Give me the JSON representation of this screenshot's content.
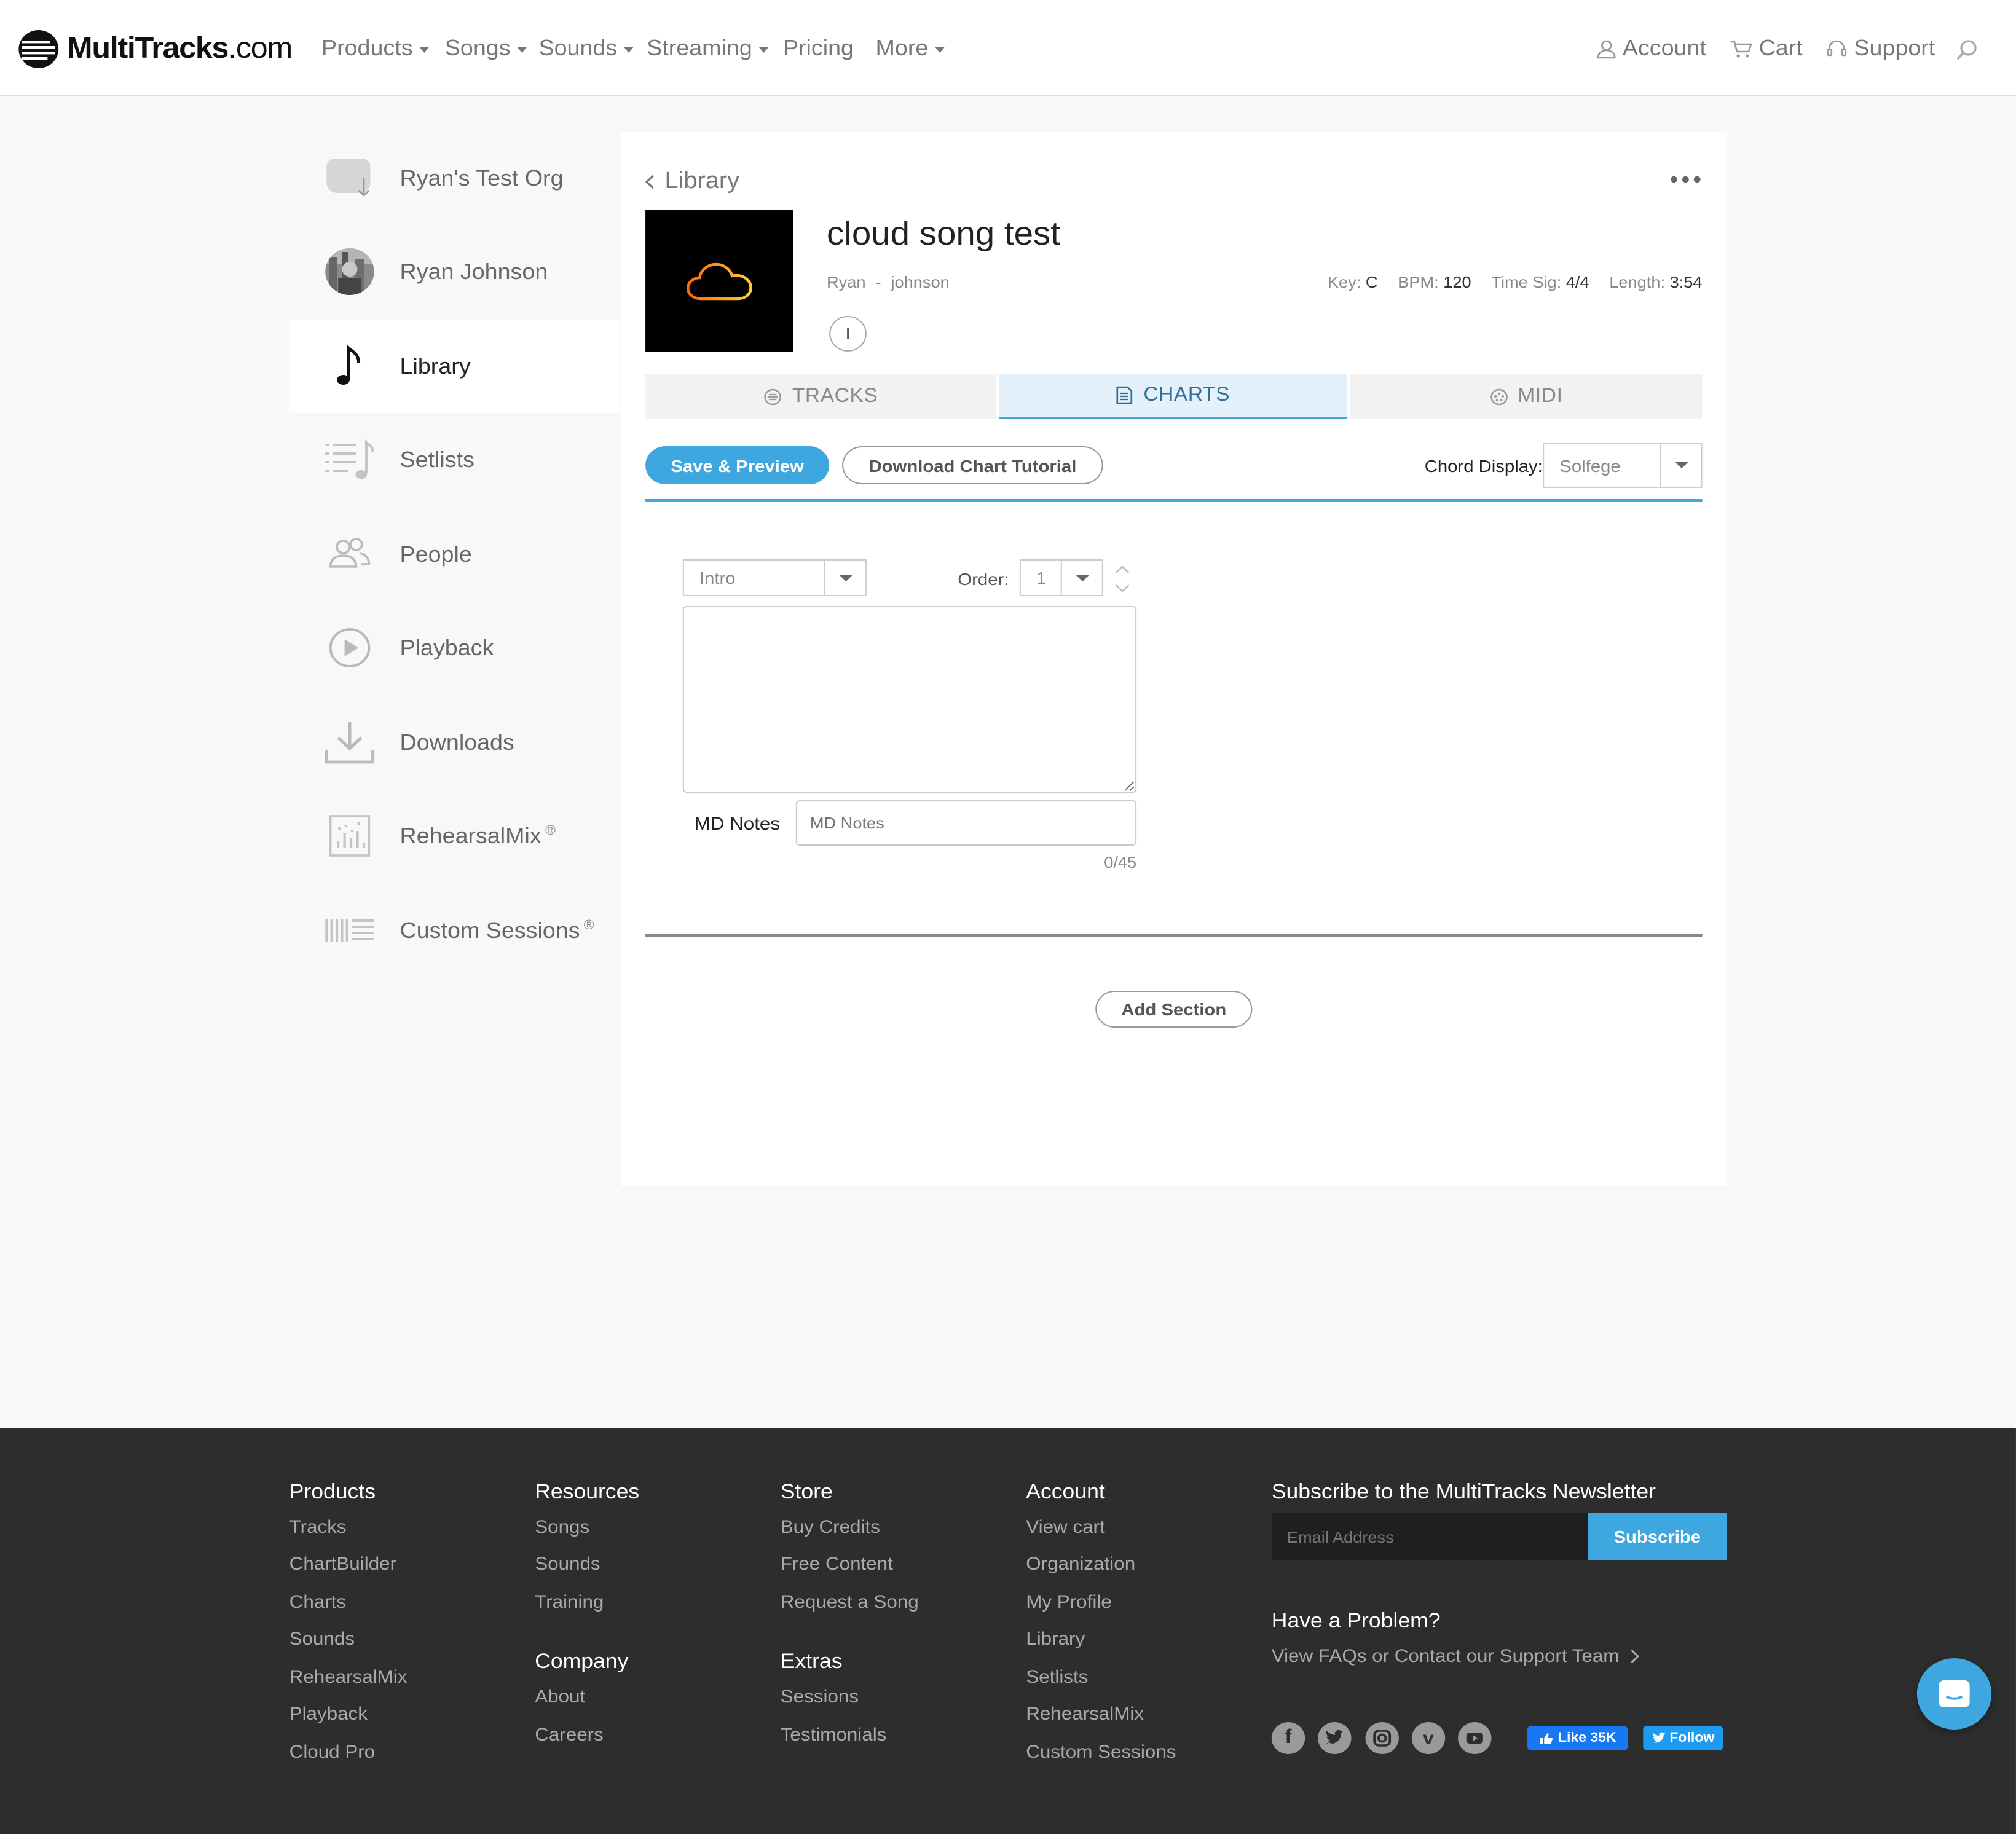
{
  "header": {
    "logo_text": "MultiTracks",
    "logo_suffix": ".com",
    "nav": [
      "Products",
      "Songs",
      "Sounds",
      "Streaming",
      "Pricing",
      "More"
    ],
    "account_label": "Account",
    "cart_label": "Cart",
    "support_label": "Support"
  },
  "sidebar": {
    "items": [
      {
        "label": "Ryan's Test Org",
        "icon": "org-avatar-icon"
      },
      {
        "label": "Ryan Johnson",
        "icon": "user-avatar"
      },
      {
        "label": "Library",
        "icon": "music-note-icon"
      },
      {
        "label": "Setlists",
        "icon": "setlist-icon"
      },
      {
        "label": "People",
        "icon": "people-icon"
      },
      {
        "label": "Playback",
        "icon": "play-circle-icon"
      },
      {
        "label": "Downloads",
        "icon": "download-icon"
      },
      {
        "label": "RehearsalMix",
        "icon": "rehearsalmix-icon",
        "sup": "®"
      },
      {
        "label": "Custom Sessions",
        "icon": "custom-sessions-icon",
        "sup": "®"
      }
    ]
  },
  "song": {
    "back_label": "Library",
    "title": "cloud song test",
    "artist": "Ryan",
    "separator": "-",
    "album": "johnson",
    "key_label": "Key:",
    "key": "C",
    "bpm_label": "BPM:",
    "bpm": "120",
    "timesig_label": "Time Sig:",
    "timesig": "4/4",
    "length_label": "Length:",
    "length": "3:54",
    "badge": "I"
  },
  "tabs": [
    {
      "label": "TRACKS",
      "icon": "tracks-icon",
      "active": false
    },
    {
      "label": "CHARTS",
      "icon": "chart-doc-icon",
      "active": true
    },
    {
      "label": "MIDI",
      "icon": "midi-icon",
      "active": false
    }
  ],
  "toolbar": {
    "save_label": "Save & Preview",
    "download_label": "Download Chart Tutorial",
    "chord_display_label": "Chord Display:",
    "chord_display_value": "Solfege"
  },
  "section": {
    "type_value": "Intro",
    "order_label": "Order:",
    "order_value": "1",
    "chart_text": "",
    "md_notes_label": "MD Notes",
    "md_notes_placeholder": "MD Notes",
    "counter": "0/45"
  },
  "add_section_label": "Add Section",
  "footer": {
    "products": {
      "heading": "Products",
      "links": [
        "Tracks",
        "ChartBuilder",
        "Charts",
        "Sounds",
        "RehearsalMix",
        "Playback",
        "Cloud Pro"
      ]
    },
    "resources": {
      "heading": "Resources",
      "links": [
        "Songs",
        "Sounds",
        "Training"
      ]
    },
    "company": {
      "heading": "Company",
      "links": [
        "About",
        "Careers"
      ]
    },
    "store": {
      "heading": "Store",
      "links": [
        "Buy Credits",
        "Free Content",
        "Request a Song"
      ]
    },
    "extras": {
      "heading": "Extras",
      "links": [
        "Sessions",
        "Testimonials"
      ]
    },
    "account": {
      "heading": "Account",
      "links": [
        "View cart",
        "Organization",
        "My Profile",
        "Library",
        "Setlists",
        "RehearsalMix",
        "Custom Sessions"
      ]
    },
    "newsletter": {
      "heading": "Subscribe to the MultiTracks Newsletter",
      "placeholder": "Email Address",
      "button": "Subscribe"
    },
    "problem": {
      "heading": "Have a Problem?",
      "link": "View FAQs or Contact our Support Team"
    },
    "social": [
      "facebook-icon",
      "twitter-icon",
      "instagram-icon",
      "vimeo-icon",
      "youtube-icon"
    ],
    "like_label": "Like 35K",
    "follow_label": "Follow"
  },
  "colors": {
    "accent": "#3ea7e0",
    "footer_bg": "#2d2d2d",
    "artwork_bg": "#000000",
    "cloud_gradient": [
      "#ff6a00",
      "#ffcc33"
    ]
  }
}
